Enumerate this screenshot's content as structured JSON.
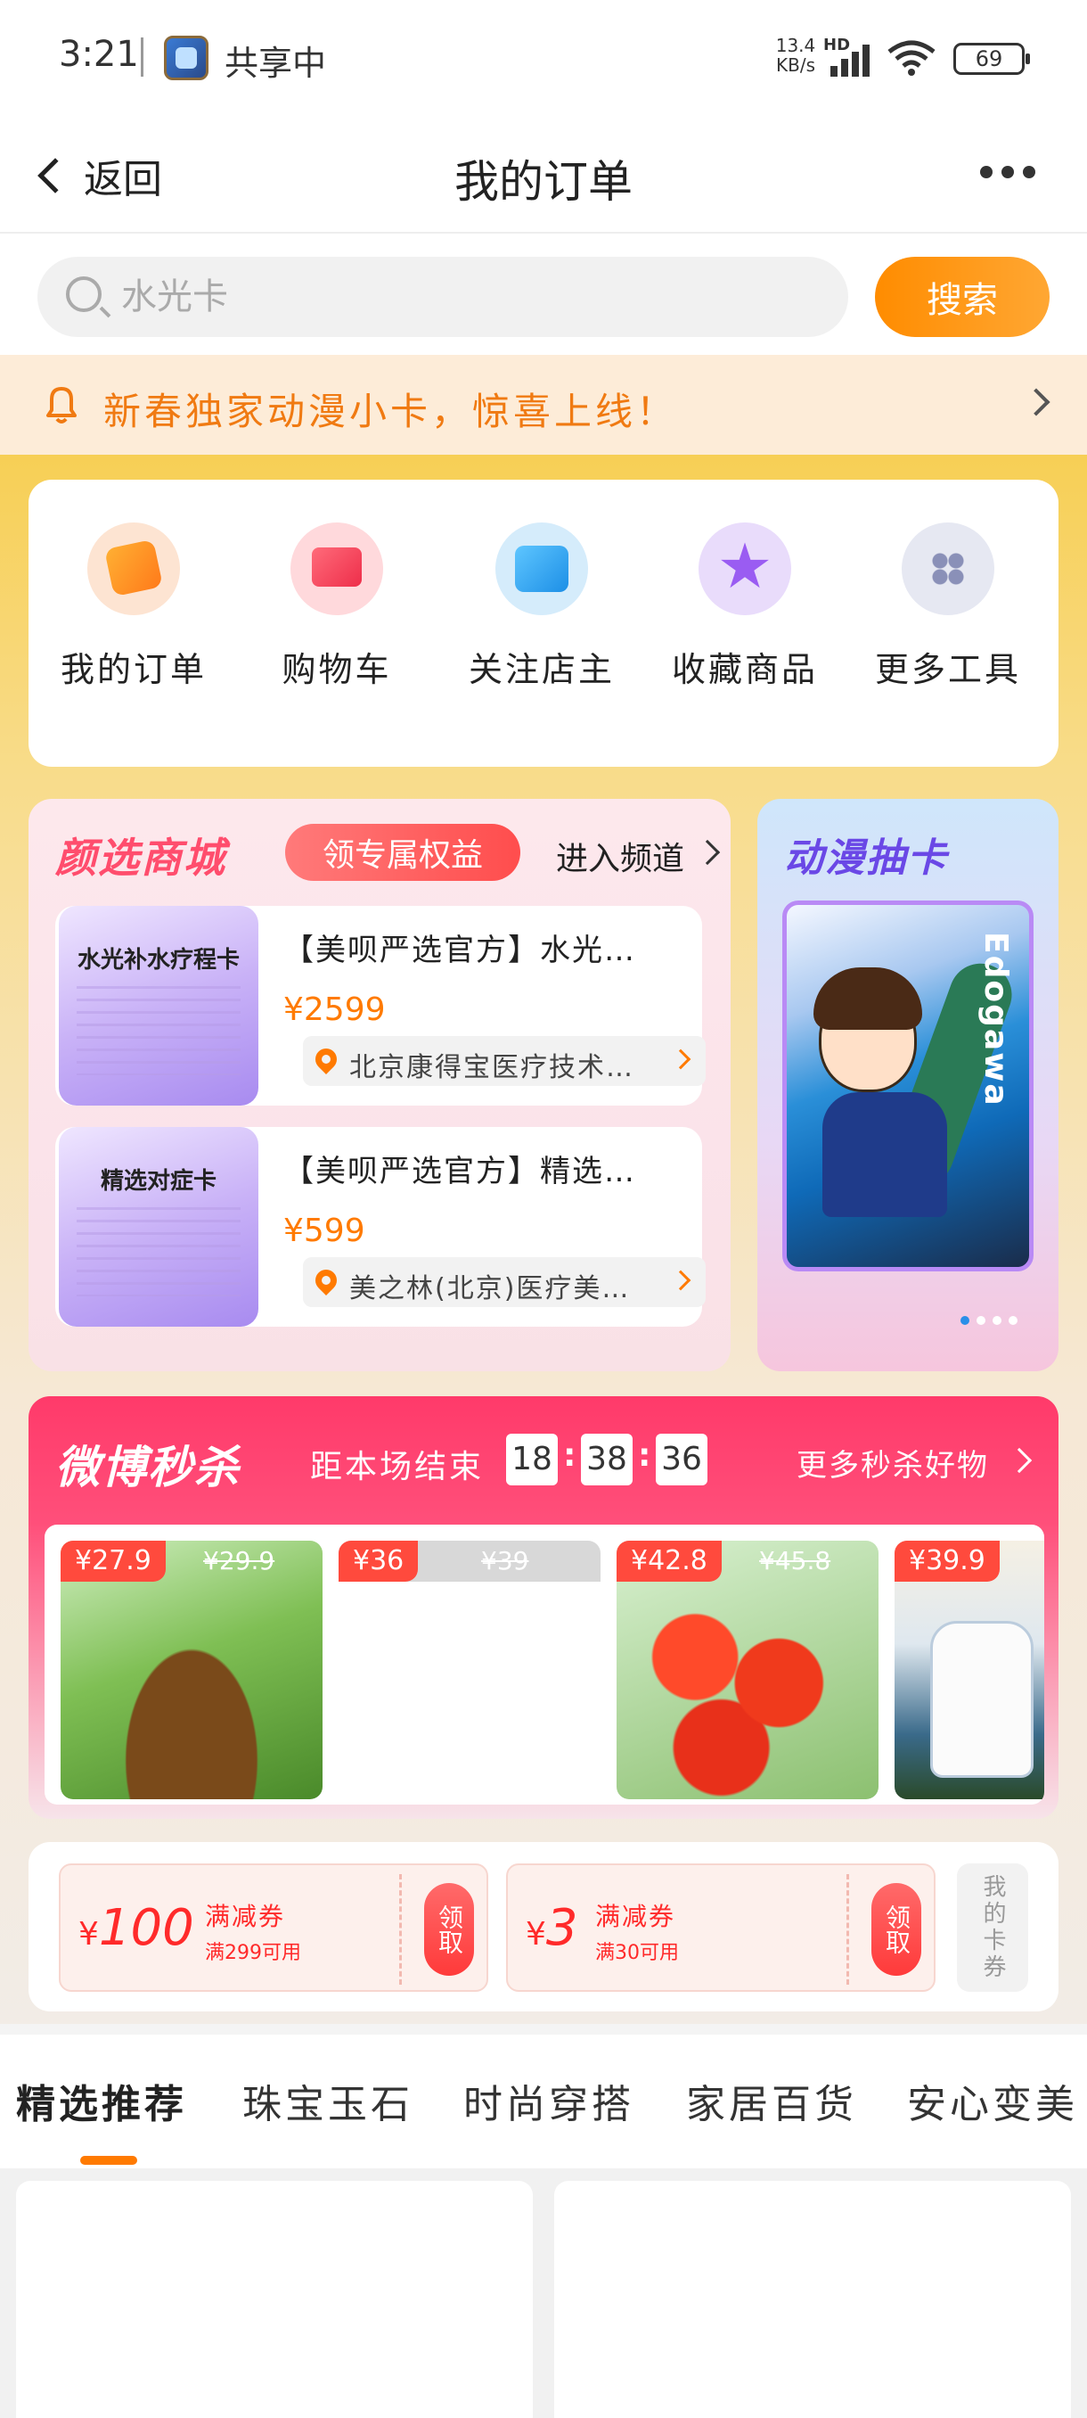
{
  "status_bar": {
    "time": "3:21",
    "share_label": "共享中",
    "net_speed_top": "13.4",
    "net_speed_bottom": "KB/s",
    "network_label": "HD",
    "battery": "69"
  },
  "nav": {
    "back_label": "返回",
    "title": "我的订单"
  },
  "search": {
    "placeholder": "水光卡",
    "button_label": "搜索"
  },
  "notice": {
    "text": "新春独家动漫小卡，惊喜上线！"
  },
  "tools": [
    {
      "label": "我的订单",
      "icon": "order-bag-icon"
    },
    {
      "label": "购物车",
      "icon": "shopping-cart-icon"
    },
    {
      "label": "关注店主",
      "icon": "store-icon"
    },
    {
      "label": "收藏商品",
      "icon": "star-icon"
    },
    {
      "label": "更多工具",
      "icon": "grid-dots-icon"
    }
  ],
  "mall": {
    "title": "颜选商城",
    "perk_label": "领专属权益",
    "enter_label": "进入频道",
    "products": [
      {
        "image_title": "水光补水疗程卡",
        "name": "【美呗严选官方】水光…",
        "price": "¥2599",
        "shop": "北京康得宝医疗技术…"
      },
      {
        "image_title": "精选对症卡",
        "name": "【美呗严选官方】精选…",
        "price": "¥599",
        "shop": "美之林(北京)医疗美…"
      }
    ]
  },
  "anime": {
    "title": "动漫抽卡",
    "card_text": "Edogawa"
  },
  "flash": {
    "title": "微博秒杀",
    "countdown_label": "距本场结束",
    "hours": "18",
    "minutes": "38",
    "seconds": "36",
    "more_label": "更多秒杀好物",
    "items": [
      {
        "price": "¥27.9",
        "orig": "¥29.9"
      },
      {
        "price": "¥36",
        "orig": "¥39"
      },
      {
        "price": "¥42.8",
        "orig": "¥45.8"
      },
      {
        "price": "¥39.9",
        "orig": ""
      }
    ]
  },
  "coupons": [
    {
      "currency": "¥",
      "amount": "100",
      "title": "满减券",
      "condition": "满299可用",
      "button": "领取"
    },
    {
      "currency": "¥",
      "amount": "3",
      "title": "满减券",
      "condition": "满30可用",
      "button": "领取"
    }
  ],
  "my_coupons_label": "我的卡券",
  "tabs": [
    "精选推荐",
    "珠宝玉石",
    "时尚穿搭",
    "家居百货",
    "安心变美"
  ]
}
